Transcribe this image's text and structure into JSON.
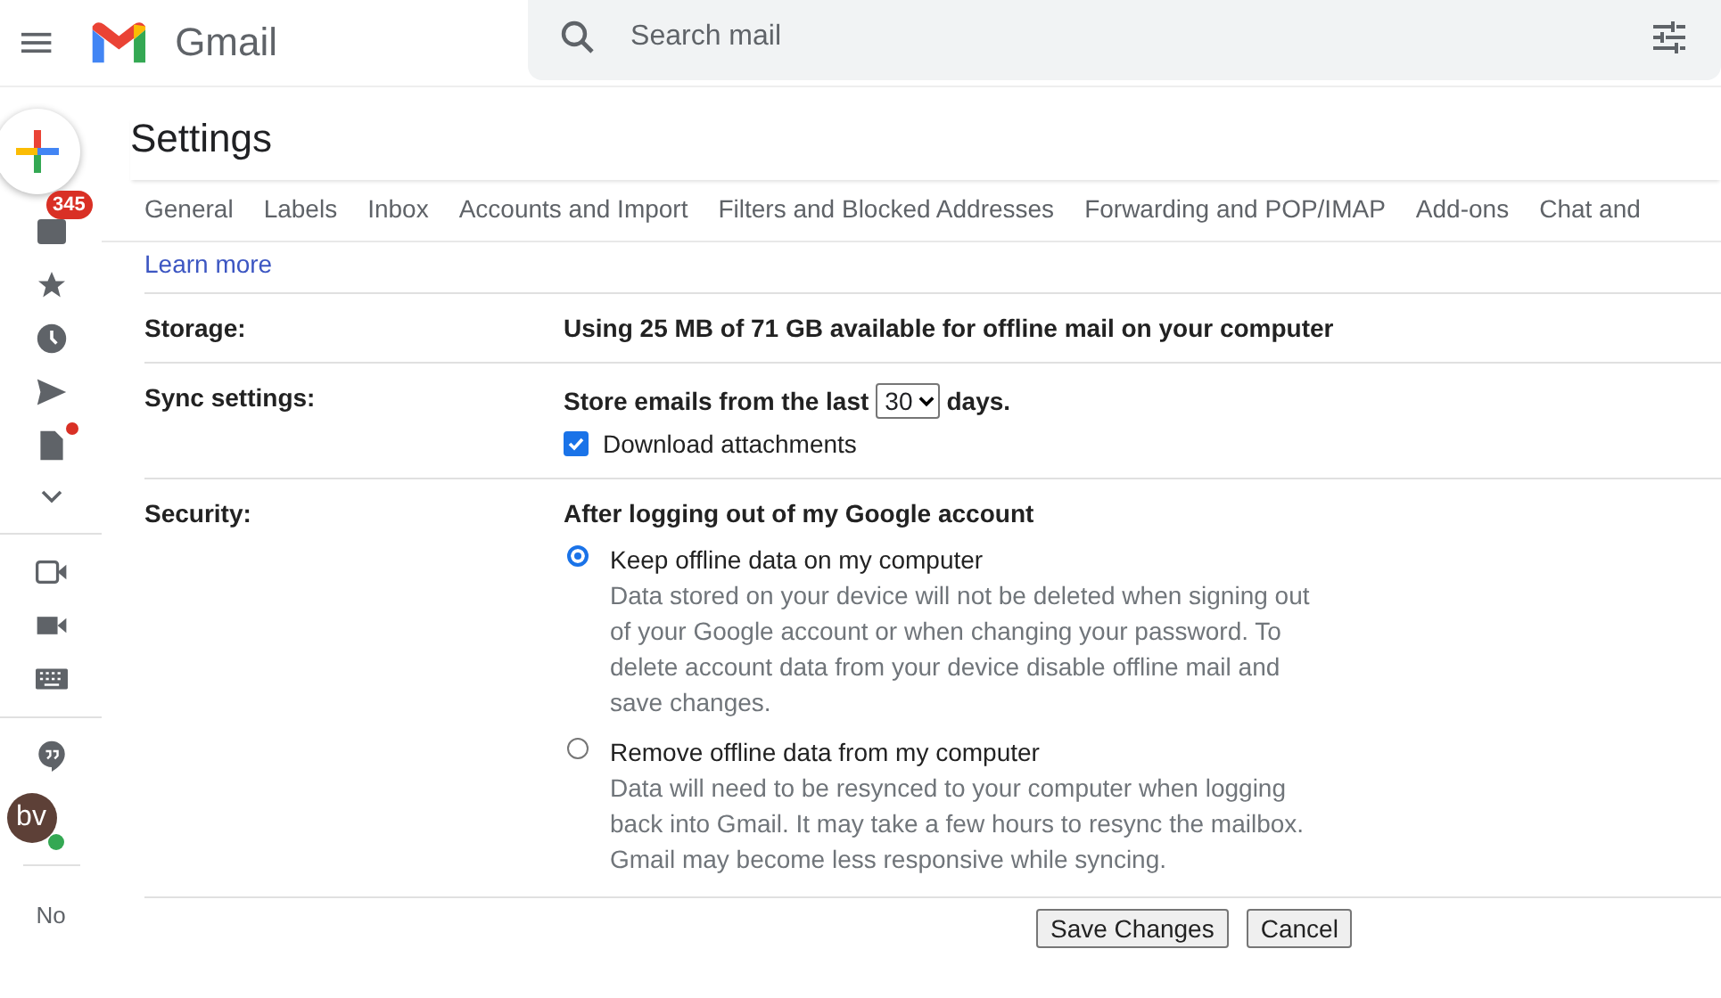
{
  "header": {
    "app_name": "Gmail",
    "search": {
      "placeholder": "Search mail"
    }
  },
  "sidebar": {
    "inbox_badge": "345",
    "drafts_alert": true,
    "avatar_initials": "bv",
    "online": true,
    "footer_text": "No"
  },
  "page_title": "Settings",
  "tabs": [
    {
      "label": "General",
      "selected": false
    },
    {
      "label": "Labels",
      "selected": false
    },
    {
      "label": "Inbox",
      "selected": false
    },
    {
      "label": "Accounts and Import",
      "selected": false
    },
    {
      "label": "Filters and Blocked Addresses",
      "selected": false
    },
    {
      "label": "Forwarding and POP/IMAP",
      "selected": false
    },
    {
      "label": "Add-ons",
      "selected": false
    },
    {
      "label": "Chat and",
      "selected": false
    }
  ],
  "learn_more": "Learn more",
  "rows": [
    {
      "kind": "text",
      "label": "Storage:",
      "value": "Using 25 MB of 71 GB available for offline mail on your computer"
    },
    {
      "kind": "sync",
      "label": "Sync settings:",
      "prefix": "Store emails from the last",
      "select_value": "30",
      "suffix": "days.",
      "checkbox": {
        "label": "Download attachments",
        "checked": true
      }
    },
    {
      "kind": "radios",
      "label": "Security:",
      "heading": "After logging out of my Google account",
      "options": [
        {
          "title": "Keep offline data on my computer",
          "description": "Data stored on your device will not be deleted when signing out of your Google account or when changing your password. To delete account data from your device disable offline mail and save changes.",
          "selected": true
        },
        {
          "title": "Remove offline data from my computer",
          "description": "Data will need to be resynced to your computer when logging back into Gmail. It may take a few hours to resync the mailbox. Gmail may become less responsive while syncing.",
          "selected": false
        }
      ]
    }
  ],
  "buttons": [
    "Save Changes",
    "Cancel"
  ]
}
